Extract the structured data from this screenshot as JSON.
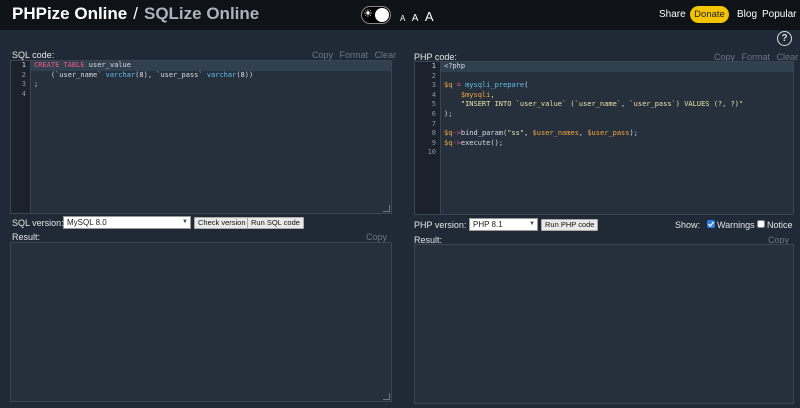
{
  "header": {
    "brand_primary": "PHPize Online",
    "brand_separator": "/",
    "brand_secondary": "SQLize Online",
    "font_sizes": [
      "A",
      "A",
      "A"
    ],
    "nav": {
      "share": "Share",
      "donate": "Donate",
      "blog": "Blog",
      "popular": "Popular"
    },
    "help": "?"
  },
  "sql_panel": {
    "code_label": "SQL code:",
    "tools": [
      "Copy",
      "Format",
      "Clear"
    ],
    "line_numbers": [
      "1",
      "2",
      "3",
      "4"
    ],
    "version_label": "SQL version:",
    "version_value": "MySQL 8.0",
    "check_button": "Check version",
    "run_button": "Run SQL code",
    "result_label": "Result:",
    "result_copy": "Copy"
  },
  "php_panel": {
    "code_label": "PHP code:",
    "tools": [
      "Copy",
      "Format",
      "Clear"
    ],
    "line_numbers": [
      "1",
      "2",
      "3",
      "4",
      "5",
      "6",
      "7",
      "8",
      "9",
      "10"
    ],
    "version_label": "PHP version:",
    "version_value": "PHP 8.1",
    "run_button": "Run PHP code",
    "show_label": "Show:",
    "warnings_label": "Warnings",
    "warnings_checked": true,
    "notice_label": "Notice",
    "notice_checked": false,
    "result_label": "Result:",
    "result_copy": "Copy"
  },
  "sql_code": {
    "l1": {
      "kw": "CREATE TABLE",
      "rest": " user_value"
    },
    "l2": {
      "a": "    (`user_name` ",
      "t1": "varchar",
      "b": "(8), `user_pass` ",
      "t2": "varchar",
      "c": "(8))"
    },
    "l3": ";"
  },
  "php_code": {
    "l1": "<?php",
    "l3": {
      "v": "$q",
      "op": " = ",
      "fn": "mysqli_prepare",
      "p": "("
    },
    "l4": {
      "v": "    $mysqli",
      "p": ","
    },
    "l5": {
      "s": "    \"INSERT INTO `user_value` (`user_name`, `user_pass`) VALUES (?, ?)\""
    },
    "l6": ");",
    "l8": {
      "v": "$q",
      "op": "->",
      "fn": "bind_param",
      "p1": "(",
      "s": "\"ss\"",
      "p2": ", ",
      "v2": "$user_names",
      "p3": ", ",
      "v3": "$user_pass",
      "p4": ");"
    },
    "l9": {
      "v": "$q",
      "op": "->",
      "fn": "execute",
      "p": "();"
    }
  },
  "colors": {
    "background": "#1f2a36",
    "header": "#0f1216",
    "donate": "#f5c400",
    "keyword": "#f0558a",
    "type": "#5fc0f0",
    "string": "#e9e3a6",
    "variable": "#f4a63b",
    "checkbox": "#2f7de1"
  },
  "icons": {
    "theme": "sun-icon",
    "help": "question-icon",
    "caret": "chevron-down-icon"
  }
}
